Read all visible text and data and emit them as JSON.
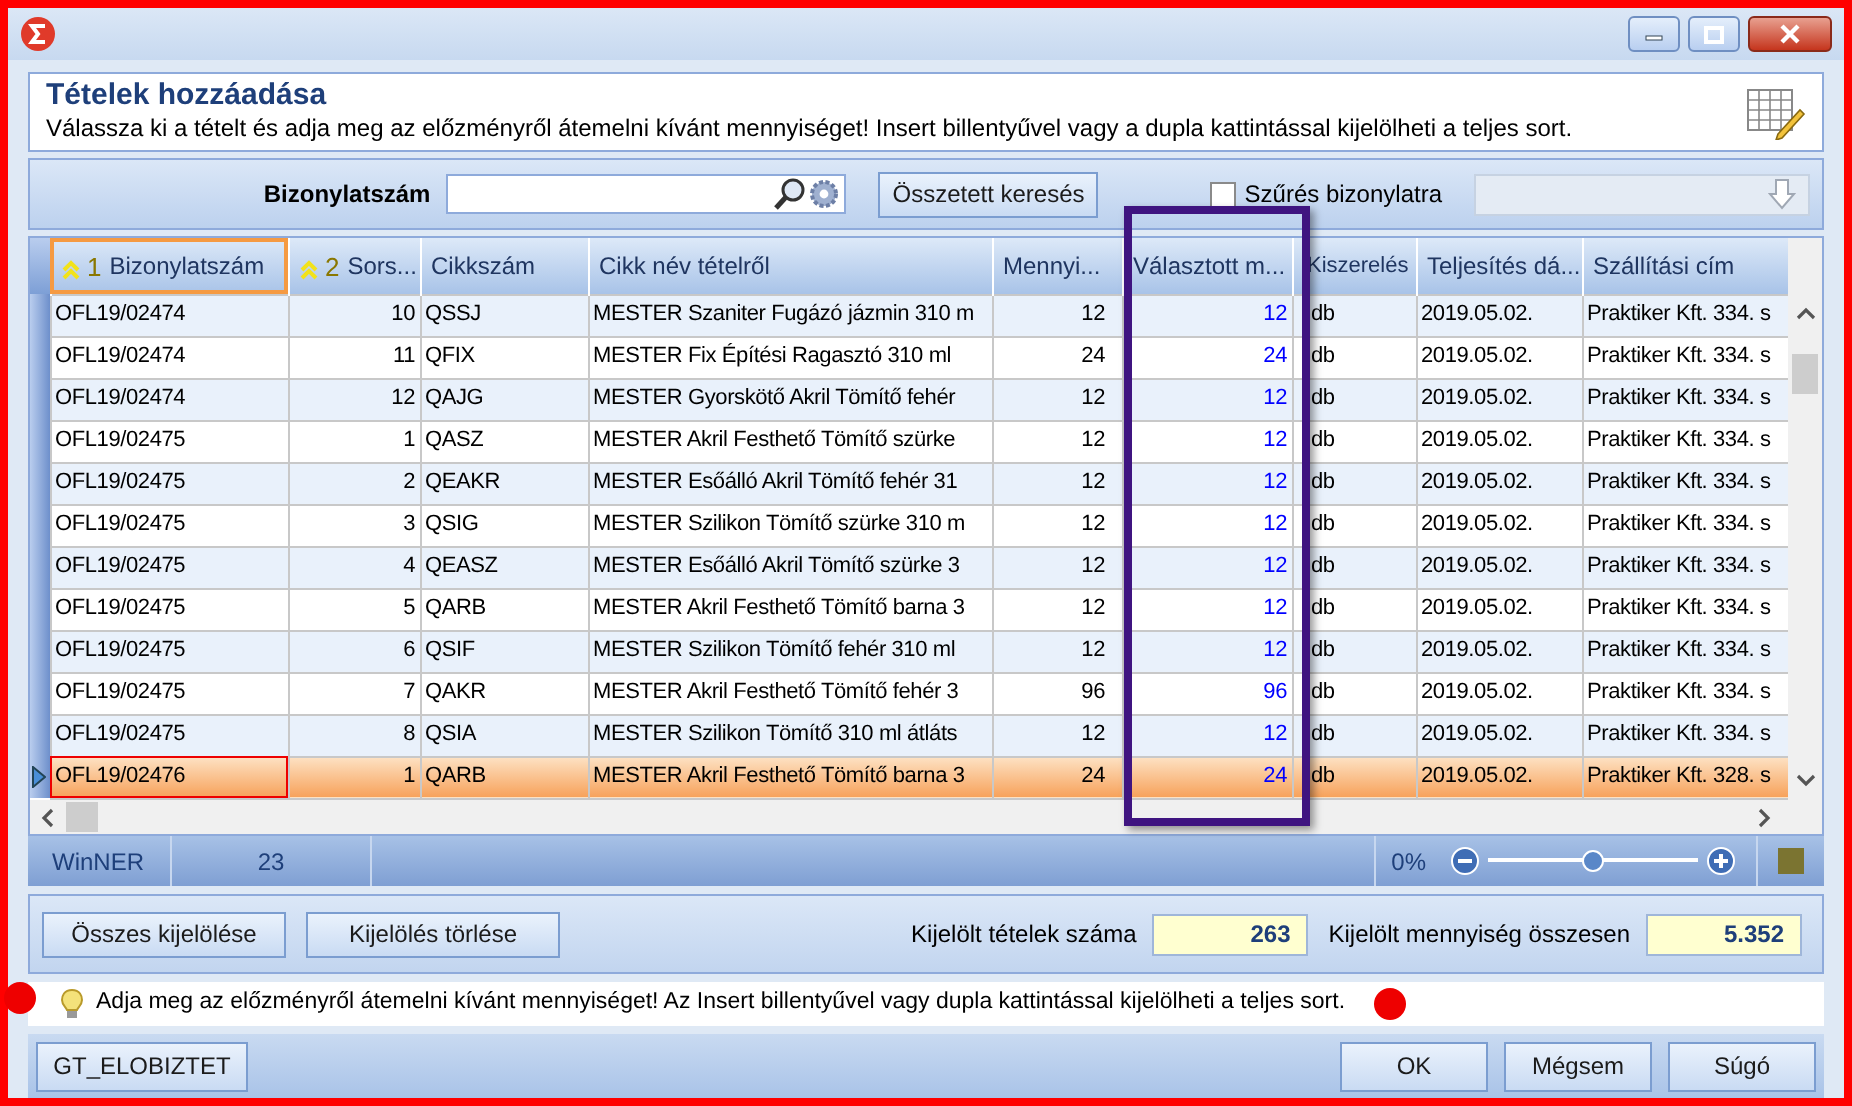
{
  "header": {
    "title": "Tételek hozzáadása",
    "subtitle": "Válassza ki a tételt és adja meg az előzményről átemelni kívánt mennyiséget! Insert billentyűvel vagy a dupla kattintással kijelölheti a teljes sort."
  },
  "search": {
    "label": "Bizonylatszám",
    "advanced_button": "Összetett keresés",
    "filter_checkbox": {
      "label": "Szűrés bizonylatra",
      "checked": false
    },
    "document_dropdown": {
      "disabled": true
    }
  },
  "table": {
    "columns": [
      {
        "label": "Bizonylatszám",
        "sort_order": "1",
        "focused": true
      },
      {
        "label": "Sors...",
        "sort_order": "2",
        "focused": false
      },
      {
        "label": "Cikkszám",
        "focused": false
      },
      {
        "label": "Cikk név tételről",
        "focused": false
      },
      {
        "label": "Mennyi...",
        "focused": false
      },
      {
        "label": "Választott m...",
        "focused": false
      },
      {
        "label": "Kiszerelés",
        "focused": false
      },
      {
        "label": "Teljesítés dá...",
        "focused": false
      },
      {
        "label": "Szállítási cím",
        "focused": false
      }
    ],
    "rows": [
      {
        "selected": false,
        "cells": [
          "OFL19/02474",
          "10",
          "QSSJ",
          "MESTER Szaniter Fugázó jázmin 310 m",
          "12",
          "12",
          "db",
          "2019.05.02.",
          "Praktiker Kft. 334. s"
        ]
      },
      {
        "selected": false,
        "cells": [
          "OFL19/02474",
          "11",
          "QFIX",
          "MESTER Fix Építési Ragasztó 310 ml",
          "24",
          "24",
          "db",
          "2019.05.02.",
          "Praktiker Kft. 334. s"
        ]
      },
      {
        "selected": false,
        "cells": [
          "OFL19/02474",
          "12",
          "QAJG",
          "MESTER Gyorskötő Akril Tömítő fehér",
          "12",
          "12",
          "db",
          "2019.05.02.",
          "Praktiker Kft. 334. s"
        ]
      },
      {
        "selected": false,
        "cells": [
          "OFL19/02475",
          "1",
          "QASZ",
          "MESTER Akril Festhető Tömítő szürke",
          "12",
          "12",
          "db",
          "2019.05.02.",
          "Praktiker Kft. 334. s"
        ]
      },
      {
        "selected": false,
        "cells": [
          "OFL19/02475",
          "2",
          "QEAKR",
          "MESTER Esőálló Akril Tömítő fehér 31",
          "12",
          "12",
          "db",
          "2019.05.02.",
          "Praktiker Kft. 334. s"
        ]
      },
      {
        "selected": false,
        "cells": [
          "OFL19/02475",
          "3",
          "QSIG",
          "MESTER Szilikon Tömítő szürke 310 m",
          "12",
          "12",
          "db",
          "2019.05.02.",
          "Praktiker Kft. 334. s"
        ]
      },
      {
        "selected": false,
        "cells": [
          "OFL19/02475",
          "4",
          "QEASZ",
          "MESTER Esőálló Akril Tömítő szürke 3",
          "12",
          "12",
          "db",
          "2019.05.02.",
          "Praktiker Kft. 334. s"
        ]
      },
      {
        "selected": false,
        "cells": [
          "OFL19/02475",
          "5",
          "QARB",
          "MESTER Akril Festhető Tömítő barna 3",
          "12",
          "12",
          "db",
          "2019.05.02.",
          "Praktiker Kft. 334. s"
        ]
      },
      {
        "selected": false,
        "cells": [
          "OFL19/02475",
          "6",
          "QSIF",
          "MESTER Szilikon Tömítő fehér 310 ml",
          "12",
          "12",
          "db",
          "2019.05.02.",
          "Praktiker Kft. 334. s"
        ]
      },
      {
        "selected": false,
        "cells": [
          "OFL19/02475",
          "7",
          "QAKR",
          "MESTER Akril Festhető Tömítő fehér 3",
          "96",
          "96",
          "db",
          "2019.05.02.",
          "Praktiker Kft. 334. s"
        ]
      },
      {
        "selected": false,
        "cells": [
          "OFL19/02475",
          "8",
          "QSIA",
          "MESTER Szilikon Tömítő 310 ml átláts",
          "12",
          "12",
          "db",
          "2019.05.02.",
          "Praktiker Kft. 334. s"
        ]
      },
      {
        "selected": true,
        "cells": [
          "OFL19/02476",
          "1",
          "QARB",
          "MESTER Akril Festhető Tömítő barna 3",
          "24",
          "24",
          "db",
          "2019.05.02.",
          "Praktiker Kft. 328. s"
        ]
      }
    ]
  },
  "status_bar": {
    "items": [
      "WinNER",
      "23"
    ],
    "zoom": {
      "reading": "0%",
      "level": 0.5
    }
  },
  "selection_panel": {
    "buttons": [
      "Összes kijelölése",
      "Kijelölés törlése"
    ],
    "fields": [
      {
        "label": "Kijelölt tételek száma",
        "value": "263"
      },
      {
        "label": "Kijelölt mennyiség összesen",
        "value": "5.352"
      }
    ]
  },
  "hint": "Adja meg az előzményről átemelni kívánt mennyiséget! Az Insert billentyűvel vagy dupla kattintással kijelölheti a teljes sort.",
  "footer": {
    "left_button": "GT_ELOBIZTET",
    "buttons": [
      "OK",
      "Mégsem",
      "Súgó"
    ]
  }
}
